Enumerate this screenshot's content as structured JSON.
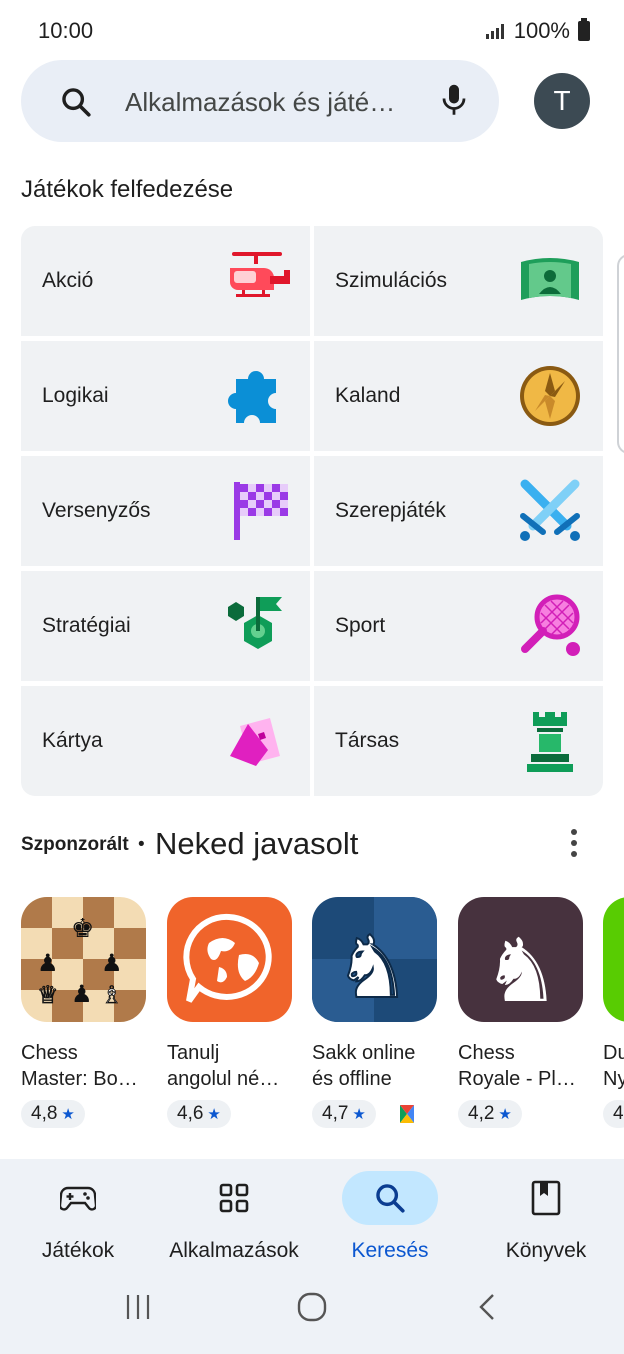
{
  "status": {
    "time": "10:00",
    "battery": "100%"
  },
  "search": {
    "placeholder": "Alkalmazások és játé…",
    "avatar_letter": "T"
  },
  "explore": {
    "title": "Játékok felfedezése",
    "categories": [
      {
        "label": "Akció",
        "icon": "helicopter-icon"
      },
      {
        "label": "Szimulációs",
        "icon": "simulation-icon"
      },
      {
        "label": "Logikai",
        "icon": "puzzle-icon"
      },
      {
        "label": "Kaland",
        "icon": "compass-icon"
      },
      {
        "label": "Versenyzős",
        "icon": "checkered-flag-icon"
      },
      {
        "label": "Szerepjáték",
        "icon": "crossed-swords-icon"
      },
      {
        "label": "Stratégiai",
        "icon": "strategy-flag-icon"
      },
      {
        "label": "Sport",
        "icon": "tennis-racket-icon"
      },
      {
        "label": "Kártya",
        "icon": "cards-icon"
      },
      {
        "label": "Társas",
        "icon": "chess-rook-icon"
      }
    ]
  },
  "recommended": {
    "sponsored": "Szponzorált",
    "separator": "•",
    "title": "Neked javasolt",
    "apps": [
      {
        "name": "Chess\nMaster: Bo…",
        "rating": "4,8"
      },
      {
        "name": "Tanulj\nangolul né…",
        "rating": "4,6"
      },
      {
        "name": "Sakk online\nés offline",
        "rating": "4,7"
      },
      {
        "name": "Chess\nRoyale - Pl…",
        "rating": "4,2"
      },
      {
        "name": "Du\nNy",
        "rating": "4"
      }
    ]
  },
  "bottom_nav": [
    {
      "label": "Játékok",
      "icon": "gamepad-icon",
      "active": false
    },
    {
      "label": "Alkalmazások",
      "icon": "apps-grid-icon",
      "active": false
    },
    {
      "label": "Keresés",
      "icon": "search-icon",
      "active": true
    },
    {
      "label": "Könyvek",
      "icon": "book-icon",
      "active": false
    }
  ],
  "colors": {
    "accent": "#0b57d0",
    "active_pill": "#c2e7ff",
    "tile": "#f0f2f4"
  }
}
